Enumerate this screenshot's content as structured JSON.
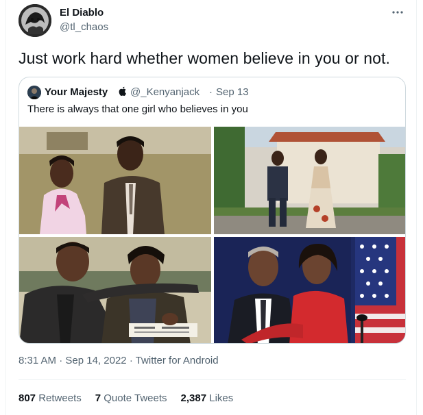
{
  "author": {
    "name": "El Diablo",
    "handle": "@tl_chaos"
  },
  "tweet": {
    "text": "Just work hard whether women believe in you or not."
  },
  "quoted": {
    "name": "Your Majesty",
    "handle": "@_Kenyanjack",
    "separator": "·",
    "date": "Sep 13",
    "text": "There is always that one girl who believes in you",
    "badge_icon": "apple-icon"
  },
  "photos": [
    {
      "description_icon": "photo-couple-vintage-1"
    },
    {
      "description_icon": "photo-couple-walking"
    },
    {
      "description_icon": "photo-couple-vintage-2"
    },
    {
      "description_icon": "photo-couple-flag"
    }
  ],
  "meta": {
    "time": "8:31 AM",
    "dot1": "·",
    "date": "Sep 14, 2022",
    "dot2": "·",
    "source": "Twitter for Android"
  },
  "stats": {
    "retweets_count": "807",
    "retweets_label": "Retweets",
    "quotes_count": "7",
    "quotes_label": "Quote Tweets",
    "likes_count": "2,387",
    "likes_label": "Likes"
  },
  "colors": {
    "text_primary": "#0f1419",
    "text_secondary": "#536471",
    "border": "#cfd9de"
  }
}
